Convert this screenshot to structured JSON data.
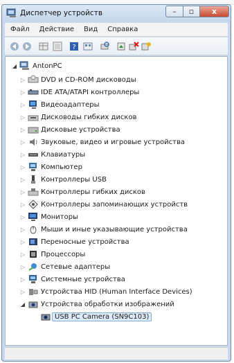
{
  "window": {
    "title": "Диспетчер устройств"
  },
  "menu": [
    "Файл",
    "Действие",
    "Вид",
    "Справка"
  ],
  "toolbar": [
    "back-icon",
    "forward-icon",
    "properties-grid-icon",
    "show-hidden-icon",
    "help-icon",
    "view-icon",
    "scan-hardware-icon",
    "update-driver-icon",
    "uninstall-icon",
    "disable-icon"
  ],
  "tree": {
    "root": "AntonPC",
    "items": [
      "DVD и CD-ROM дисководы",
      "IDE ATA/ATAPI контроллеры",
      "Видеоадаптеры",
      "Дисководы гибких дисков",
      "Дисковые устройства",
      "Звуковые, видео и игровые устройства",
      "Клавиатуры",
      "Компьютер",
      "Контроллеры USB",
      "Контроллеры гибких дисков",
      "Контроллеры запоминающих устройств",
      "Мониторы",
      "Мыши и иные указывающие устройства",
      "Переносные устройства",
      "Процессоры",
      "Сетевые адаптеры",
      "Системные устройства",
      "Устройства HID (Human Interface Devices)",
      "Устройства обработки изображений"
    ],
    "child": "USB PC Camera (SN9C103)"
  }
}
